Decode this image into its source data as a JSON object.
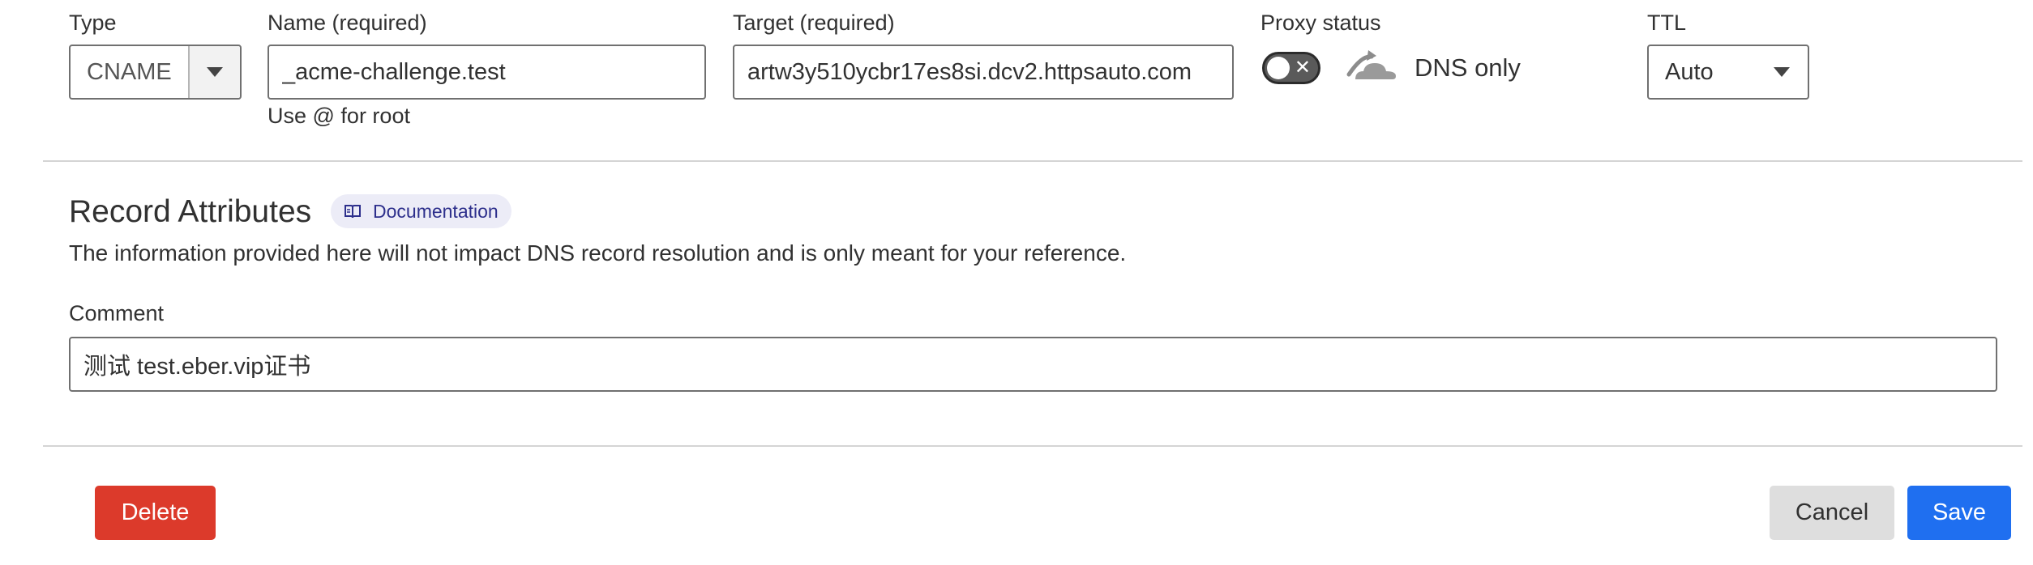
{
  "labels": {
    "type": "Type",
    "name": "Name (required)",
    "target": "Target (required)",
    "proxy": "Proxy status",
    "ttl": "TTL"
  },
  "type_field": {
    "value": "CNAME"
  },
  "name_field": {
    "value": "_acme-challenge.test",
    "hint": "Use @ for root"
  },
  "target_field": {
    "value": "artw3y510ycbr17es8si.dcv2.httpsauto.com"
  },
  "proxy": {
    "status_text": "DNS only",
    "toggle_on": false,
    "toggle_glyph": "✕",
    "icon": "cloud-icon"
  },
  "ttl_field": {
    "value": "Auto"
  },
  "record_attributes": {
    "title": "Record Attributes",
    "doc_label": "Documentation",
    "description": "The information provided here will not impact DNS record resolution and is only meant for your reference."
  },
  "comment": {
    "label": "Comment",
    "value": "测试 test.eber.vip证书"
  },
  "buttons": {
    "delete": "Delete",
    "cancel": "Cancel",
    "save": "Save"
  },
  "colors": {
    "delete": "#dc3a2b",
    "save": "#1f6ff0",
    "cancel_bg": "#dedede",
    "accent_badge": "#ececf7"
  }
}
